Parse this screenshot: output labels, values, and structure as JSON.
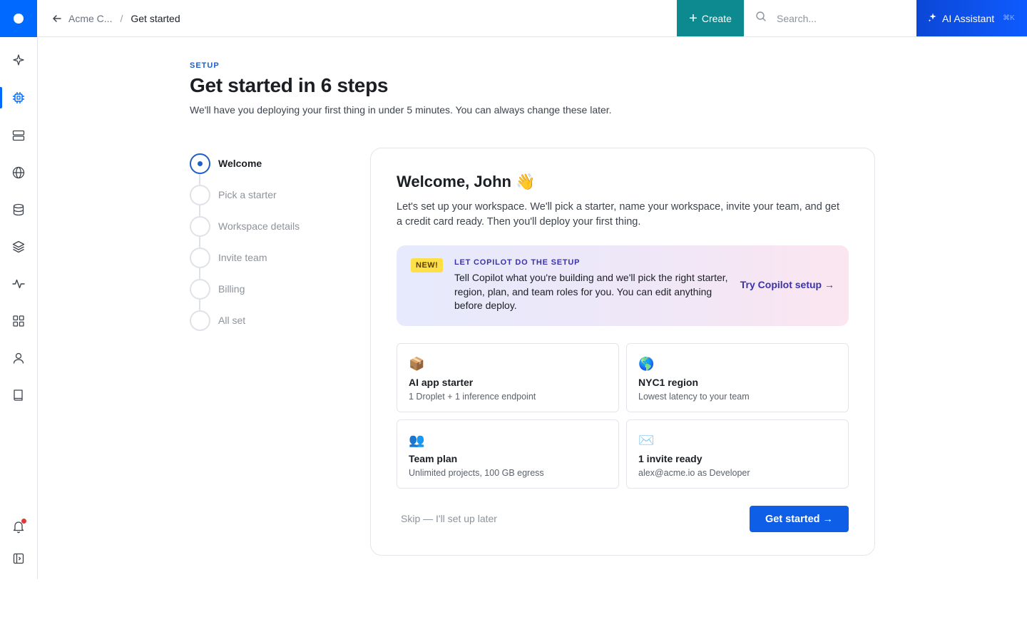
{
  "topbar": {
    "breadcrumb_parent": "Acme C...",
    "breadcrumb_separator": "/",
    "breadcrumb_current": "Get started",
    "create_label": "Create",
    "search_placeholder": "Search...",
    "ai_label": "AI Assistant",
    "ai_shortcut": "⌘K"
  },
  "sidebar": {
    "items": [
      {
        "icon": "sparkle-icon"
      },
      {
        "icon": "chip-icon",
        "active": true
      },
      {
        "icon": "server-icon"
      },
      {
        "icon": "globe-icon"
      },
      {
        "icon": "database-icon"
      },
      {
        "icon": "layers-icon"
      },
      {
        "icon": "activity-icon"
      },
      {
        "icon": "apps-grid-icon"
      },
      {
        "icon": "user-icon"
      },
      {
        "icon": "book-icon"
      }
    ],
    "bottom_items": [
      {
        "icon": "bell-icon",
        "has_notification": true
      },
      {
        "icon": "collapse-sidebar-icon"
      }
    ]
  },
  "header": {
    "eyebrow": "SETUP",
    "title": "Get started in 6 steps",
    "subtitle": "We'll have you deploying your first thing in under 5 minutes. You can always change these later."
  },
  "steps": [
    {
      "label": "Welcome",
      "current": true
    },
    {
      "label": "Pick a starter"
    },
    {
      "label": "Workspace details"
    },
    {
      "label": "Invite team"
    },
    {
      "label": "Billing"
    },
    {
      "label": "All set"
    }
  ],
  "card": {
    "title": "Welcome, John 👋",
    "description": "Let's set up your workspace. We'll pick a starter, name your workspace, invite your team, and get a credit card ready. Then you'll deploy your first thing.",
    "copilot": {
      "badge": "NEW!",
      "heading": "LET COPILOT DO THE SETUP",
      "body": "Tell Copilot what you're building and we'll pick the right starter, region, plan, and team roles for you. You can edit anything before deploy.",
      "link": "Try Copilot setup →"
    },
    "tiles": [
      {
        "emoji": "📦",
        "title": "AI app starter",
        "subtitle": "1 Droplet + 1 inference endpoint"
      },
      {
        "emoji": "🌎",
        "title": "NYC1 region",
        "subtitle": "Lowest latency to your team"
      },
      {
        "emoji": "👥",
        "title": "Team plan",
        "subtitle": "Unlimited projects, 100 GB egress"
      },
      {
        "emoji": "✉️",
        "title": "1 invite ready",
        "subtitle": "alex@acme.io as Developer"
      }
    ],
    "skip_label": "Skip — I'll set up later",
    "primary_label": "Get started →"
  },
  "colors": {
    "brand": "#0069ff",
    "create": "#0d8a8f",
    "primary": "#0f5ee8",
    "accent_text": "#1f5fc9",
    "copilot_text": "#3b34a8",
    "badge": "#fde047"
  }
}
